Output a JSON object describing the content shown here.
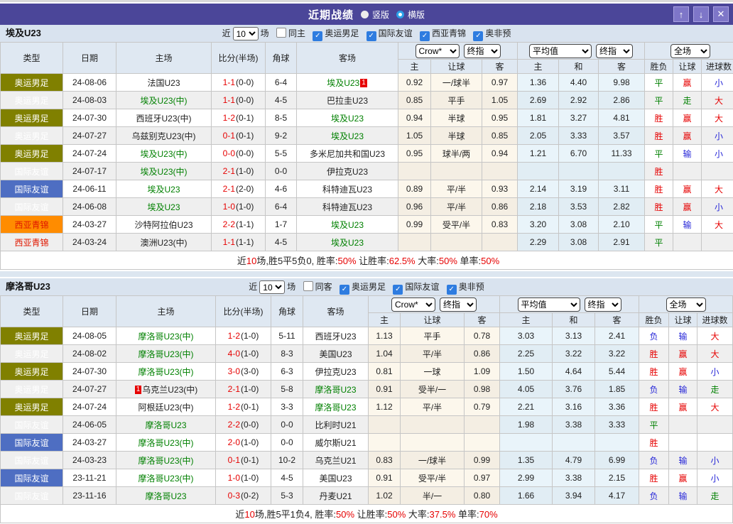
{
  "titlebar": {
    "title": "近期战绩",
    "radios": [
      {
        "label": "竖版",
        "selected": false
      },
      {
        "label": "横版",
        "selected": true
      }
    ],
    "buttons": {
      "up": "↑",
      "down": "↓",
      "close": "✕"
    },
    "bg_color": "#4b4699"
  },
  "colors": {
    "win_red": "#e60000",
    "draw_green": "#008000",
    "lose_blue": "#2626d8",
    "olympic_bg": "#808000",
    "friendly_bg": "#4e6ec2",
    "wasia_bg": "#ff8c00",
    "team_green": "#008000"
  },
  "sections": [
    {
      "team": "埃及U23",
      "filter": {
        "near": "近",
        "count": "10",
        "games_label": "场",
        "same_label": "同主",
        "same_checked": false,
        "categories": [
          "奥运男足",
          "国际友谊",
          "西亚青锦",
          "奥非预"
        ]
      },
      "columns": [
        "类型",
        "日期",
        "主场",
        "比分(半场)",
        "角球",
        "客场"
      ],
      "selects": [
        "Crow*",
        "终指",
        "平均值",
        "终指",
        "全场"
      ],
      "sub": [
        "主",
        "让球",
        "客",
        "主",
        "和",
        "客",
        "胜负",
        "让球",
        "进球数"
      ],
      "rows": [
        {
          "tc": "t-oly",
          "type": "奥运男足",
          "date": "24-08-06",
          "home": "法国U23",
          "hg": false,
          "hb": "",
          "score": "1-1",
          "half": "(0-0)",
          "corner": "6-4",
          "away": "埃及U23",
          "ag": true,
          "ab": "1",
          "crow": [
            "0.92",
            "一/球半",
            "0.97"
          ],
          "euro": [
            "1.36",
            "4.40",
            "9.98"
          ],
          "res": [
            [
              "平",
              "#008000"
            ],
            [
              "赢",
              "#e60000"
            ],
            [
              "小",
              "#2626d8"
            ]
          ]
        },
        {
          "tc": "t-oly",
          "type": "奥运男足",
          "date": "24-08-03",
          "home": "埃及U23(中)",
          "hg": true,
          "hb": "",
          "score": "1-1",
          "half": "(0-0)",
          "corner": "4-5",
          "away": "巴拉圭U23",
          "ag": false,
          "ab": "",
          "crow": [
            "0.85",
            "平手",
            "1.05"
          ],
          "euro": [
            "2.69",
            "2.92",
            "2.86"
          ],
          "res": [
            [
              "平",
              "#008000"
            ],
            [
              "走",
              "#008000"
            ],
            [
              "大",
              "#e60000"
            ]
          ]
        },
        {
          "tc": "t-oly",
          "type": "奥运男足",
          "date": "24-07-30",
          "home": "西班牙U23(中)",
          "hg": false,
          "hb": "",
          "score": "1-2",
          "half": "(0-1)",
          "corner": "8-5",
          "away": "埃及U23",
          "ag": true,
          "ab": "",
          "crow": [
            "0.94",
            "半球",
            "0.95"
          ],
          "euro": [
            "1.81",
            "3.27",
            "4.81"
          ],
          "res": [
            [
              "胜",
              "#e60000"
            ],
            [
              "赢",
              "#e60000"
            ],
            [
              "大",
              "#e60000"
            ]
          ]
        },
        {
          "tc": "t-oly",
          "type": "奥运男足",
          "date": "24-07-27",
          "home": "乌兹别克U23(中)",
          "hg": false,
          "hb": "",
          "score": "0-1",
          "half": "(0-1)",
          "corner": "9-2",
          "away": "埃及U23",
          "ag": true,
          "ab": "",
          "crow": [
            "1.05",
            "半球",
            "0.85"
          ],
          "euro": [
            "2.05",
            "3.33",
            "3.57"
          ],
          "res": [
            [
              "胜",
              "#e60000"
            ],
            [
              "赢",
              "#e60000"
            ],
            [
              "小",
              "#2626d8"
            ]
          ]
        },
        {
          "tc": "t-oly",
          "type": "奥运男足",
          "date": "24-07-24",
          "home": "埃及U23(中)",
          "hg": true,
          "hb": "",
          "score": "0-0",
          "half": "(0-0)",
          "corner": "5-5",
          "away": "多米尼加共和国U23",
          "ag": false,
          "ab": "",
          "crow": [
            "0.95",
            "球半/两",
            "0.94"
          ],
          "euro": [
            "1.21",
            "6.70",
            "11.33"
          ],
          "res": [
            [
              "平",
              "#008000"
            ],
            [
              "输",
              "#2626d8"
            ],
            [
              "小",
              "#2626d8"
            ]
          ]
        },
        {
          "tc": "t-fri",
          "type": "国际友谊",
          "date": "24-07-17",
          "home": "埃及U23(中)",
          "hg": true,
          "hb": "",
          "score": "2-1",
          "half": "(1-0)",
          "corner": "0-0",
          "away": "伊拉克U23",
          "ag": false,
          "ab": "",
          "crow": [
            "",
            "",
            ""
          ],
          "euro": [
            "",
            "",
            ""
          ],
          "res": [
            [
              "胜",
              "#e60000"
            ],
            [
              "",
              ""
            ],
            [
              "",
              ""
            ]
          ]
        },
        {
          "tc": "t-fri",
          "type": "国际友谊",
          "date": "24-06-11",
          "home": "埃及U23",
          "hg": true,
          "hb": "",
          "score": "2-1",
          "half": "(2-0)",
          "corner": "4-6",
          "away": "科特迪瓦U23",
          "ag": false,
          "ab": "",
          "crow": [
            "0.89",
            "平/半",
            "0.93"
          ],
          "euro": [
            "2.14",
            "3.19",
            "3.11"
          ],
          "res": [
            [
              "胜",
              "#e60000"
            ],
            [
              "赢",
              "#e60000"
            ],
            [
              "大",
              "#e60000"
            ]
          ]
        },
        {
          "tc": "t-fri",
          "type": "国际友谊",
          "date": "24-06-08",
          "home": "埃及U23",
          "hg": true,
          "hb": "",
          "score": "1-0",
          "half": "(1-0)",
          "corner": "6-4",
          "away": "科特迪瓦U23",
          "ag": false,
          "ab": "",
          "crow": [
            "0.96",
            "平/半",
            "0.86"
          ],
          "euro": [
            "2.18",
            "3.53",
            "2.82"
          ],
          "res": [
            [
              "胜",
              "#e60000"
            ],
            [
              "赢",
              "#e60000"
            ],
            [
              "小",
              "#2626d8"
            ]
          ]
        },
        {
          "tc": "t-wa",
          "type": "西亚青锦",
          "date": "24-03-27",
          "home": "沙特阿拉伯U23",
          "hg": false,
          "hb": "",
          "score": "2-2",
          "half": "(1-1)",
          "corner": "1-7",
          "away": "埃及U23",
          "ag": true,
          "ab": "",
          "crow": [
            "0.99",
            "受平/半",
            "0.83"
          ],
          "euro": [
            "3.20",
            "3.08",
            "2.10"
          ],
          "res": [
            [
              "平",
              "#008000"
            ],
            [
              "输",
              "#2626d8"
            ],
            [
              "大",
              "#e60000"
            ]
          ]
        },
        {
          "tc": "t-wa",
          "type": "西亚青锦",
          "date": "24-03-24",
          "home": "澳洲U23(中)",
          "hg": false,
          "hb": "",
          "score": "1-1",
          "half": "(1-1)",
          "corner": "4-5",
          "away": "埃及U23",
          "ag": true,
          "ab": "",
          "crow": [
            "",
            "",
            ""
          ],
          "euro": [
            "2.29",
            "3.08",
            "2.91"
          ],
          "res": [
            [
              "平",
              "#008000"
            ],
            [
              "",
              ""
            ],
            [
              "",
              ""
            ]
          ]
        }
      ],
      "summary": [
        [
          "近",
          "#222"
        ],
        [
          "10",
          "#e60000"
        ],
        [
          "场,胜5平5负0, 胜率:",
          "#222"
        ],
        [
          "50%",
          "#e60000"
        ],
        [
          " 让胜率:",
          "#222"
        ],
        [
          "62.5%",
          "#e60000"
        ],
        [
          " 大率:",
          "#222"
        ],
        [
          "50%",
          "#e60000"
        ],
        [
          " 单率:",
          "#222"
        ],
        [
          "50%",
          "#e60000"
        ]
      ]
    },
    {
      "team": "摩洛哥U23",
      "filter": {
        "near": "近",
        "count": "10",
        "games_label": "场",
        "same_label": "同客",
        "same_checked": false,
        "categories": [
          "奥运男足",
          "国际友谊",
          "奥非预"
        ]
      },
      "columns": [
        "类型",
        "日期",
        "主场",
        "比分(半场)",
        "角球",
        "客场"
      ],
      "selects": [
        "Crow*",
        "终指",
        "平均值",
        "终指",
        "全场"
      ],
      "sub": [
        "主",
        "让球",
        "客",
        "主",
        "和",
        "客",
        "胜负",
        "让球",
        "进球数"
      ],
      "rows": [
        {
          "tc": "t-oly",
          "type": "奥运男足",
          "date": "24-08-05",
          "home": "摩洛哥U23(中)",
          "hg": true,
          "hb": "",
          "score": "1-2",
          "half": "(1-0)",
          "corner": "5-11",
          "away": "西班牙U23",
          "ag": false,
          "ab": "",
          "crow": [
            "1.13",
            "平手",
            "0.78"
          ],
          "euro": [
            "3.03",
            "3.13",
            "2.41"
          ],
          "res": [
            [
              "负",
              "#2626d8"
            ],
            [
              "输",
              "#2626d8"
            ],
            [
              "大",
              "#e60000"
            ]
          ]
        },
        {
          "tc": "t-oly",
          "type": "奥运男足",
          "date": "24-08-02",
          "home": "摩洛哥U23(中)",
          "hg": true,
          "hb": "",
          "score": "4-0",
          "half": "(1-0)",
          "corner": "8-3",
          "away": "美国U23",
          "ag": false,
          "ab": "",
          "crow": [
            "1.04",
            "平/半",
            "0.86"
          ],
          "euro": [
            "2.25",
            "3.22",
            "3.22"
          ],
          "res": [
            [
              "胜",
              "#e60000"
            ],
            [
              "赢",
              "#e60000"
            ],
            [
              "大",
              "#e60000"
            ]
          ]
        },
        {
          "tc": "t-oly",
          "type": "奥运男足",
          "date": "24-07-30",
          "home": "摩洛哥U23(中)",
          "hg": true,
          "hb": "",
          "score": "3-0",
          "half": "(3-0)",
          "corner": "6-3",
          "away": "伊拉克U23",
          "ag": false,
          "ab": "",
          "crow": [
            "0.81",
            "一球",
            "1.09"
          ],
          "euro": [
            "1.50",
            "4.64",
            "5.44"
          ],
          "res": [
            [
              "胜",
              "#e60000"
            ],
            [
              "赢",
              "#e60000"
            ],
            [
              "小",
              "#2626d8"
            ]
          ]
        },
        {
          "tc": "t-oly",
          "type": "奥运男足",
          "date": "24-07-27",
          "home": "乌克兰U23(中)",
          "hg": false,
          "hb": "1",
          "score": "2-1",
          "half": "(1-0)",
          "corner": "5-8",
          "away": "摩洛哥U23",
          "ag": true,
          "ab": "",
          "crow": [
            "0.91",
            "受半/一",
            "0.98"
          ],
          "euro": [
            "4.05",
            "3.76",
            "1.85"
          ],
          "res": [
            [
              "负",
              "#2626d8"
            ],
            [
              "输",
              "#2626d8"
            ],
            [
              "走",
              "#008000"
            ]
          ]
        },
        {
          "tc": "t-oly",
          "type": "奥运男足",
          "date": "24-07-24",
          "home": "阿根廷U23(中)",
          "hg": false,
          "hb": "",
          "score": "1-2",
          "half": "(0-1)",
          "corner": "3-3",
          "away": "摩洛哥U23",
          "ag": true,
          "ab": "",
          "crow": [
            "1.12",
            "平/半",
            "0.79"
          ],
          "euro": [
            "2.21",
            "3.16",
            "3.36"
          ],
          "res": [
            [
              "胜",
              "#e60000"
            ],
            [
              "赢",
              "#e60000"
            ],
            [
              "大",
              "#e60000"
            ]
          ]
        },
        {
          "tc": "t-fri",
          "type": "国际友谊",
          "date": "24-06-05",
          "home": "摩洛哥U23",
          "hg": true,
          "hb": "",
          "score": "2-2",
          "half": "(0-0)",
          "corner": "0-0",
          "away": "比利时U21",
          "ag": false,
          "ab": "",
          "crow": [
            "",
            "",
            ""
          ],
          "euro": [
            "1.98",
            "3.38",
            "3.33"
          ],
          "res": [
            [
              "平",
              "#008000"
            ],
            [
              "",
              ""
            ],
            [
              "",
              ""
            ]
          ]
        },
        {
          "tc": "t-fri",
          "type": "国际友谊",
          "date": "24-03-27",
          "home": "摩洛哥U23(中)",
          "hg": true,
          "hb": "",
          "score": "2-0",
          "half": "(1-0)",
          "corner": "0-0",
          "away": "威尔斯U21",
          "ag": false,
          "ab": "",
          "crow": [
            "",
            "",
            ""
          ],
          "euro": [
            "",
            "",
            ""
          ],
          "res": [
            [
              "胜",
              "#e60000"
            ],
            [
              "",
              ""
            ],
            [
              "",
              ""
            ]
          ]
        },
        {
          "tc": "t-fri",
          "type": "国际友谊",
          "date": "24-03-23",
          "home": "摩洛哥U23(中)",
          "hg": true,
          "hb": "",
          "score": "0-1",
          "half": "(0-1)",
          "corner": "10-2",
          "away": "乌克兰U21",
          "ag": false,
          "ab": "",
          "crow": [
            "0.83",
            "一/球半",
            "0.99"
          ],
          "euro": [
            "1.35",
            "4.79",
            "6.99"
          ],
          "res": [
            [
              "负",
              "#2626d8"
            ],
            [
              "输",
              "#2626d8"
            ],
            [
              "小",
              "#2626d8"
            ]
          ]
        },
        {
          "tc": "t-fri",
          "type": "国际友谊",
          "date": "23-11-21",
          "home": "摩洛哥U23(中)",
          "hg": true,
          "hb": "",
          "score": "1-0",
          "half": "(1-0)",
          "corner": "4-5",
          "away": "美国U23",
          "ag": false,
          "ab": "",
          "crow": [
            "0.91",
            "受平/半",
            "0.97"
          ],
          "euro": [
            "2.99",
            "3.38",
            "2.15"
          ],
          "res": [
            [
              "胜",
              "#e60000"
            ],
            [
              "赢",
              "#e60000"
            ],
            [
              "小",
              "#2626d8"
            ]
          ]
        },
        {
          "tc": "t-fri",
          "type": "国际友谊",
          "date": "23-11-16",
          "home": "摩洛哥U23",
          "hg": true,
          "hb": "",
          "score": "0-3",
          "half": "(0-2)",
          "corner": "5-3",
          "away": "丹麦U21",
          "ag": false,
          "ab": "",
          "crow": [
            "1.02",
            "半/一",
            "0.80"
          ],
          "euro": [
            "1.66",
            "3.94",
            "4.17"
          ],
          "res": [
            [
              "负",
              "#2626d8"
            ],
            [
              "输",
              "#2626d8"
            ],
            [
              "走",
              "#008000"
            ]
          ]
        }
      ],
      "summary": [
        [
          "近",
          "#222"
        ],
        [
          "10",
          "#e60000"
        ],
        [
          "场,胜5平1负4, 胜率:",
          "#222"
        ],
        [
          "50%",
          "#e60000"
        ],
        [
          " 让胜率:",
          "#222"
        ],
        [
          "50%",
          "#e60000"
        ],
        [
          " 大率:",
          "#222"
        ],
        [
          "37.5%",
          "#e60000"
        ],
        [
          " 单率:",
          "#222"
        ],
        [
          "70%",
          "#e60000"
        ]
      ]
    }
  ]
}
